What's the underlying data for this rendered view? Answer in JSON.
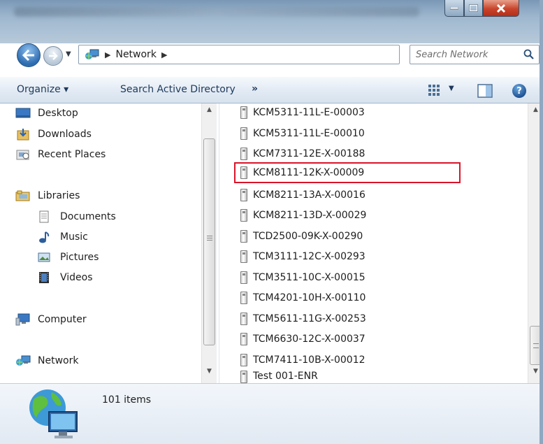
{
  "window": {
    "minimize_icon": "minimize-icon",
    "maximize_icon": "maximize-icon",
    "close_icon": "close-icon"
  },
  "nav": {
    "back_icon": "back-arrow-icon",
    "forward_icon": "forward-arrow-icon"
  },
  "address": {
    "location": "Network"
  },
  "search": {
    "placeholder": "Search Network"
  },
  "toolbar": {
    "organize_label": "Organize ▾",
    "search_ad_label": "Search Active Directory",
    "more_label": "»"
  },
  "sidebar": {
    "favorites": [
      {
        "label": "Desktop",
        "icon": "desktop-icon"
      },
      {
        "label": "Downloads",
        "icon": "downloads-icon"
      },
      {
        "label": "Recent Places",
        "icon": "recent-places-icon"
      }
    ],
    "libraries": {
      "label": "Libraries",
      "icon": "libraries-icon"
    },
    "library_items": [
      {
        "label": "Documents",
        "icon": "documents-icon"
      },
      {
        "label": "Music",
        "icon": "music-icon"
      },
      {
        "label": "Pictures",
        "icon": "pictures-icon"
      },
      {
        "label": "Videos",
        "icon": "videos-icon"
      }
    ],
    "computer": {
      "label": "Computer",
      "icon": "computer-icon"
    },
    "network": {
      "label": "Network",
      "icon": "network-icon"
    }
  },
  "files": [
    "KCM5311-11L-E-00003",
    "KCM5311-11L-E-00010",
    "KCM7311-12E-X-00188",
    "KCM8111-12K-X-00009",
    "KCM8211-13A-X-00016",
    "KCM8211-13D-X-00029",
    "TCD2500-09K-X-00290",
    "TCM3111-12C-X-00293",
    "TCM3511-10C-X-00015",
    "TCM4201-10H-X-00110",
    "TCM5611-11G-X-00253",
    "TCM6630-12C-X-00037",
    "TCM7411-10B-X-00012",
    "Test 001-ENR"
  ],
  "selected_file": "KCM8111-12K-X-00009",
  "highlight_color": "#d9142a",
  "details": {
    "count": "101 items"
  }
}
